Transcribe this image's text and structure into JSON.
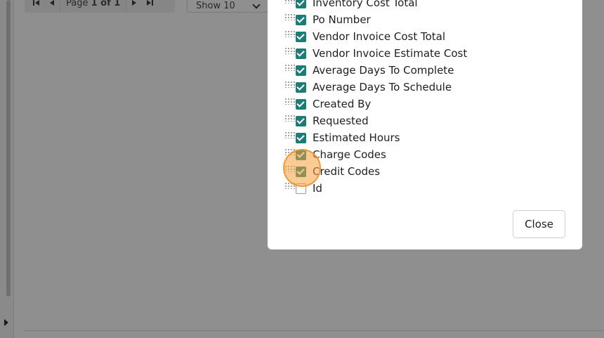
{
  "pager": {
    "page_prefix": "Page ",
    "page_current": "1 of 1"
  },
  "show_select": {
    "value": "Show 10"
  },
  "column_chooser": {
    "items": [
      {
        "label": "Inventory Cost Total",
        "checked": true
      },
      {
        "label": "Po Number",
        "checked": true
      },
      {
        "label": "Vendor Invoice Cost Total",
        "checked": true
      },
      {
        "label": "Vendor Invoice Estimate Cost",
        "checked": true
      },
      {
        "label": "Average Days To Complete",
        "checked": true
      },
      {
        "label": "Average Days To Schedule",
        "checked": true
      },
      {
        "label": "Created By",
        "checked": true
      },
      {
        "label": "Requested",
        "checked": true
      },
      {
        "label": "Estimated Hours",
        "checked": true
      },
      {
        "label": "Charge Codes",
        "checked": true
      },
      {
        "label": "Credit Codes",
        "checked": true
      },
      {
        "label": "Id",
        "checked": false
      }
    ],
    "close_label": "Close"
  },
  "colors": {
    "checkbox_checked": "#1b7d76",
    "overlay": "#8f8f8f",
    "click_highlight": "#f5a03c"
  }
}
